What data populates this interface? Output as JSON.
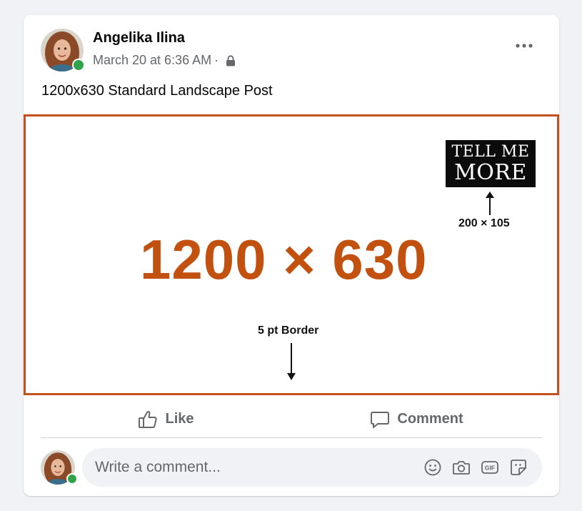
{
  "post": {
    "author": "Angelika Ilina",
    "timestamp": "March 20 at 6:36 AM",
    "separator": "·",
    "privacy_icon": "lock-icon",
    "text": "1200x630 Standard Landscape Post",
    "online": true
  },
  "image": {
    "dimension_label": "1200 × 630",
    "cta_line1": "TELL ME",
    "cta_line2": "MORE",
    "cta_dimension": "200 × 105",
    "border_label": "5 pt Border",
    "accent_color": "#c2500f",
    "border_color": "#c2511d"
  },
  "actions": {
    "like_label": "Like",
    "comment_label": "Comment"
  },
  "comment": {
    "placeholder": "Write a comment...",
    "tools": [
      "emoji-icon",
      "camera-icon",
      "gif-icon",
      "sticker-icon"
    ]
  },
  "colors": {
    "page_bg": "#f0f2f5",
    "card_bg": "#ffffff",
    "secondary_text": "#65676b",
    "online_green": "#31a24c"
  }
}
